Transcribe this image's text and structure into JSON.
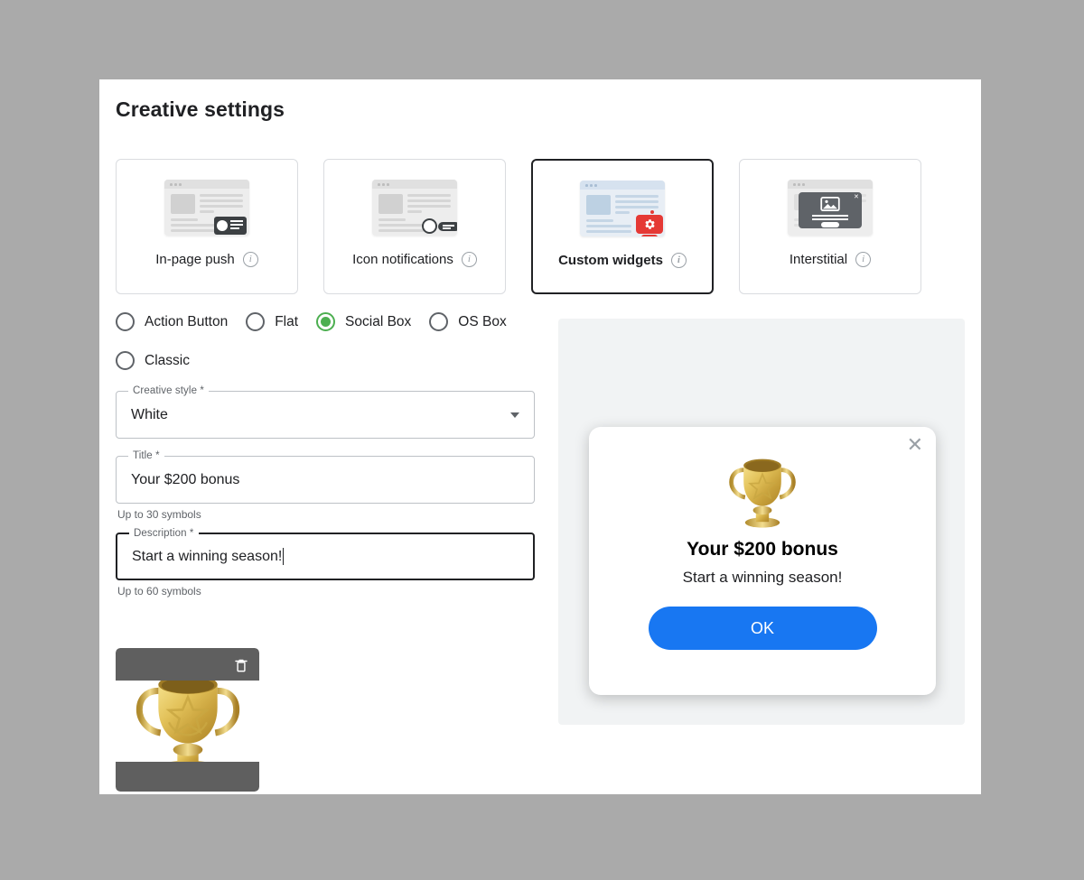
{
  "page": {
    "title": "Creative settings"
  },
  "creative_types": [
    {
      "label": "In-page push",
      "icon": "in-page-push-mock-icon",
      "info_icon": "info-icon",
      "active": false
    },
    {
      "label": "Icon notifications",
      "icon": "icon-notifications-mock-icon",
      "info_icon": "info-icon",
      "active": false
    },
    {
      "label": "Custom widgets",
      "icon": "custom-widgets-mock-icon",
      "info_icon": "info-icon",
      "active": true
    },
    {
      "label": "Interstitial",
      "icon": "interstitial-mock-icon",
      "info_icon": "info-icon",
      "active": false
    }
  ],
  "widget_styles": {
    "row1": [
      {
        "label": "Action Button",
        "selected": false
      },
      {
        "label": "Flat",
        "selected": false
      },
      {
        "label": "Social Box",
        "selected": true
      },
      {
        "label": "OS Box",
        "selected": false
      }
    ],
    "row2": [
      {
        "label": "Classic",
        "selected": false
      }
    ]
  },
  "form": {
    "creative_style": {
      "label": "Creative style *",
      "value": "White",
      "dropdown_icon": "chevron-down-icon"
    },
    "title": {
      "label": "Title *",
      "value": "Your $200 bonus",
      "hint": "Up to 30 symbols"
    },
    "description": {
      "label": "Description *",
      "value": "Start a winning season!",
      "hint": "Up to 60 symbols",
      "focused": true
    },
    "image": {
      "alt": "trophy-image",
      "delete_icon": "trash-icon"
    }
  },
  "preview": {
    "close_icon": "✕",
    "image": "trophy-image",
    "title": "Your $200 bonus",
    "description": "Start a winning season!",
    "button_label": "OK"
  },
  "colors": {
    "accent_blue": "#1877f2",
    "radio_green": "#4caf50",
    "badge_red": "#e53935",
    "panel_bg": "#ffffff",
    "page_bg": "#aaaaaa",
    "preview_bg": "#f1f3f4",
    "border": "#dadce0",
    "text": "#202124",
    "muted_text": "#5f6368"
  }
}
